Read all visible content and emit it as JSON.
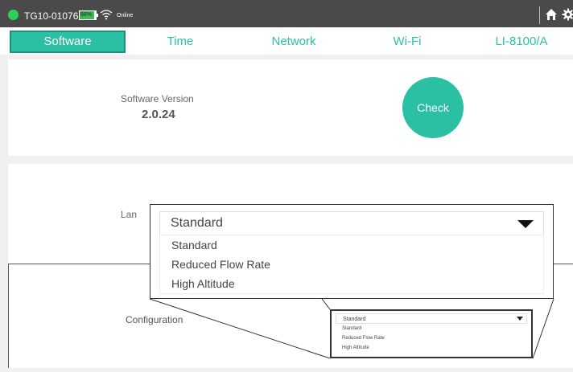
{
  "status_bar": {
    "device_id": "TG10-01076",
    "battery_percent": "88%",
    "battery_level": 0.88,
    "connection": "Online"
  },
  "tabs": [
    {
      "label": "Software",
      "active": true
    },
    {
      "label": "Time",
      "active": false
    },
    {
      "label": "Network",
      "active": false
    },
    {
      "label": "Wi-Fi",
      "active": false
    },
    {
      "label": "LI-8100/A",
      "active": false
    }
  ],
  "software": {
    "version_label": "Software Version",
    "version_value": "2.0.24",
    "check_label": "Check"
  },
  "language": {
    "label": "Lan"
  },
  "configuration": {
    "label": "Configuration",
    "selected": "Standard",
    "options": [
      "Standard",
      "Reduced Flow Rate",
      "High Altitude"
    ]
  },
  "colors": {
    "accent": "#2bbfa4",
    "topbar": "#4a4a4a",
    "online_led": "#29d15a"
  },
  "icons": [
    "wifi-icon",
    "home-icon",
    "gear-icon",
    "chevron-down-icon"
  ]
}
